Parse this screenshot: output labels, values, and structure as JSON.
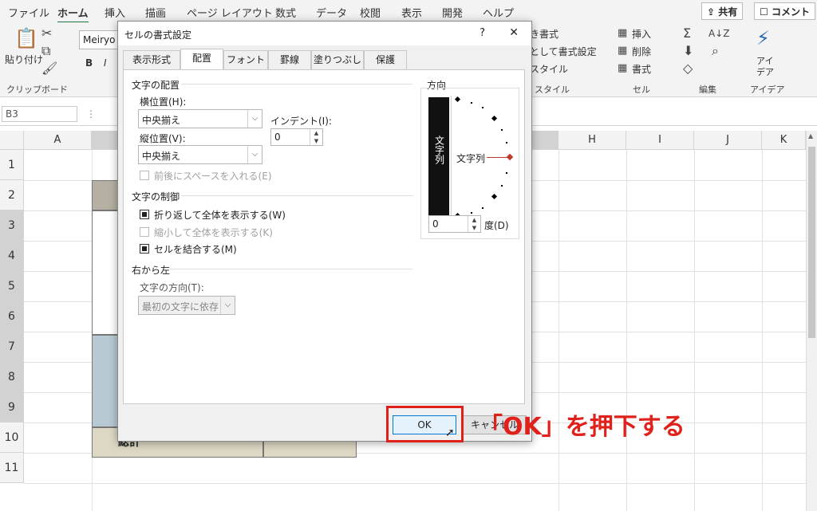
{
  "ribbon": {
    "tabs": [
      "ファイル",
      "ホーム",
      "挿入",
      "描画",
      "ページ レイアウト",
      "数式",
      "データ",
      "校閲",
      "表示",
      "開発",
      "ヘルプ"
    ],
    "share": "共有",
    "comment": "コメント",
    "clipboard_label": "クリップボード",
    "paste_label": "貼り付け",
    "font_name": "Meiryo U",
    "bold": "B",
    "italic": "I",
    "style_label": "スタイル",
    "style_items": [
      "き書式",
      "として書式設定",
      "スタイル"
    ],
    "cells_label": "セル",
    "cells_items": [
      "挿入",
      "削除",
      "書式"
    ],
    "edit_label": "編集",
    "ideas_label": "アイデア",
    "ideas_button_1": "アイ",
    "ideas_button_2": "デア"
  },
  "formula_bar": {
    "name_box": "B3"
  },
  "sheet": {
    "columns": [
      "A",
      "H",
      "I",
      "J",
      "K"
    ],
    "rows": [
      "1",
      "2",
      "3",
      "4",
      "5",
      "6",
      "7",
      "8",
      "9",
      "10",
      "11"
    ],
    "total_label": "総計"
  },
  "dialog": {
    "title": "セルの書式設定",
    "help": "?",
    "close": "✕",
    "tabs": [
      "表示形式",
      "配置",
      "フォント",
      "罫線",
      "塗りつぶし",
      "保護"
    ],
    "text_alignment_heading": "文字の配置",
    "horizontal_label": "横位置(H):",
    "horizontal_value": "中央揃え",
    "indent_label": "インデント(I):",
    "indent_value": "0",
    "vertical_label": "縦位置(V):",
    "vertical_value": "中央揃え",
    "distributed_label": "前後にスペースを入れる(E)",
    "text_control_heading": "文字の制御",
    "wrap_label": "折り返して全体を表示する(W)",
    "shrink_label": "縮小して全体を表示する(K)",
    "merge_label": "セルを結合する(M)",
    "rtl_heading": "右から左",
    "direction_label": "文字の方向(T):",
    "direction_value": "最初の文字に依存",
    "orientation_heading": "方向",
    "vertical_text": "文字列",
    "orientation_text": "文字列",
    "degrees_value": "0",
    "degrees_label": "度(D)",
    "ok": "OK",
    "cancel": "キャンセル"
  },
  "annotation": "「OK」を押下する",
  "colors": {
    "accent_green": "#217346",
    "annotation_red": "#e0201a",
    "header_fill": "#b5b0a3",
    "blue_fill": "#b7c9d3",
    "total_fill": "#ddd8c4"
  }
}
